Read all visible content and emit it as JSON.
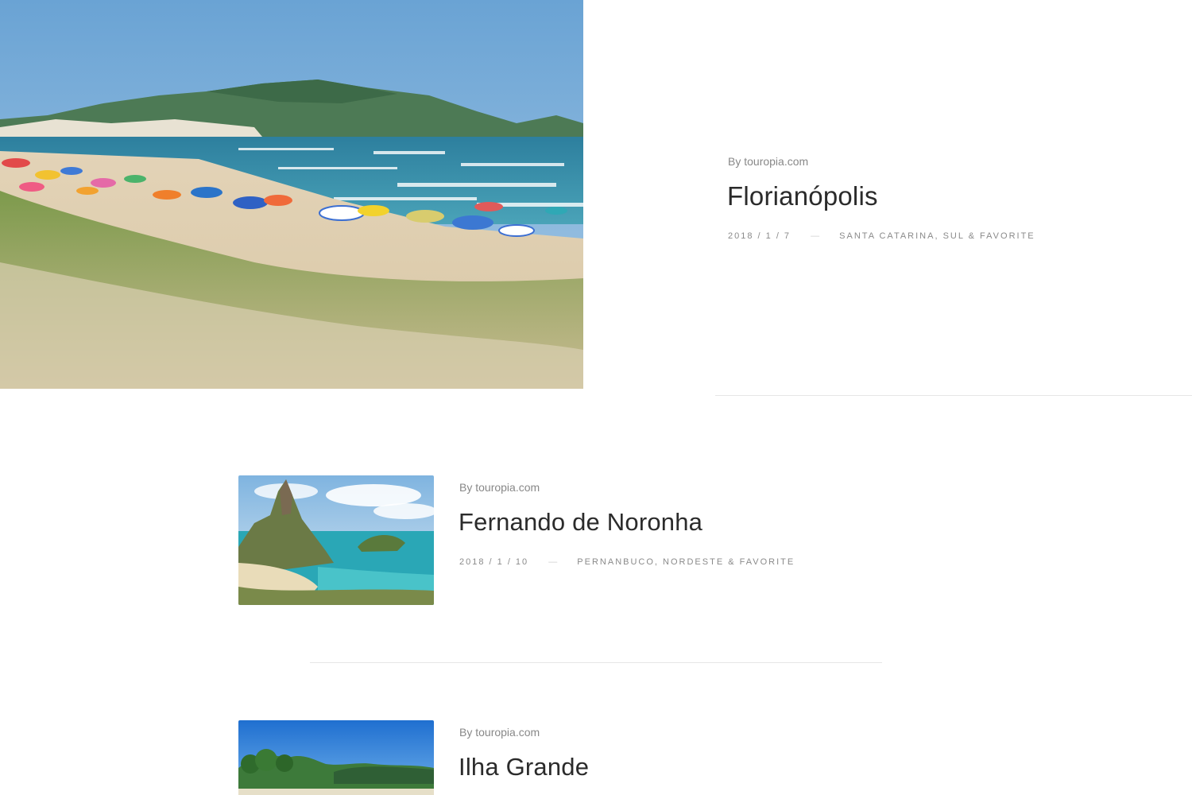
{
  "posts": [
    {
      "author": "By touropia.com",
      "title": "Florianópolis",
      "date": "2018 / 1 / 7",
      "separator": "—",
      "categories": [
        "Santa Catarina",
        ", ",
        "Sul",
        " & ",
        "Favorite"
      ],
      "image_alt": "Beach with umbrellas and green hills"
    },
    {
      "author": "By touropia.com",
      "title": "Fernando de Noronha",
      "date": "2018 / 1 / 10",
      "separator": "—",
      "categories": [
        "Pernanbuco",
        ", ",
        "Nordeste",
        " & ",
        "Favorite"
      ],
      "image_alt": "Island peak and turquoise bay"
    },
    {
      "author": "By touropia.com",
      "title": "Ilha Grande",
      "image_alt": "Tropical beach with palm trees"
    }
  ]
}
